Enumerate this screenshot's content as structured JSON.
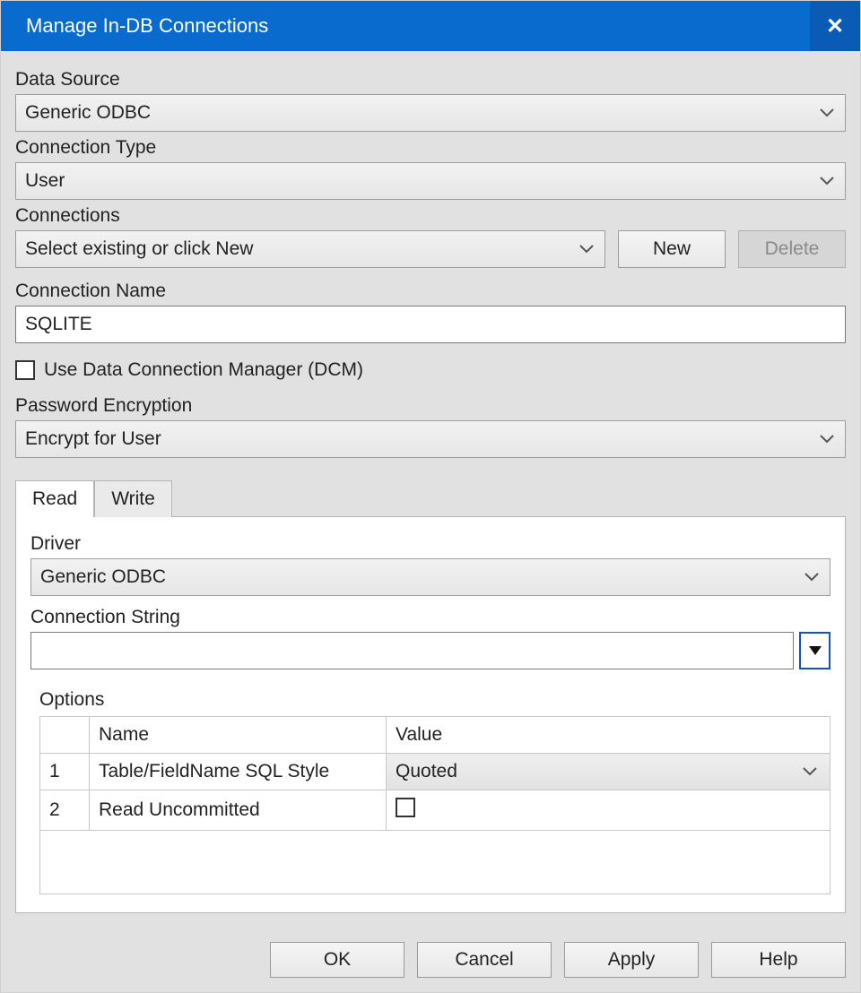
{
  "title": "Manage In-DB Connections",
  "close_glyph": "✕",
  "labels": {
    "data_source": "Data Source",
    "connection_type": "Connection Type",
    "connections": "Connections",
    "connection_name": "Connection Name",
    "use_dcm": "Use Data Connection Manager (DCM)",
    "password_encryption": "Password Encryption",
    "driver": "Driver",
    "connection_string": "Connection String",
    "options": "Options"
  },
  "values": {
    "data_source": "Generic ODBC",
    "connection_type": "User",
    "connections": "Select existing or click New",
    "connection_name": "SQLITE",
    "use_dcm_checked": false,
    "password_encryption": "Encrypt for User",
    "driver": "Generic ODBC",
    "connection_string": ""
  },
  "buttons": {
    "new": "New",
    "delete": "Delete",
    "ok": "OK",
    "cancel": "Cancel",
    "apply": "Apply",
    "help": "Help"
  },
  "tabs": {
    "read": "Read",
    "write": "Write"
  },
  "options_table": {
    "headers": {
      "idx": "",
      "name": "Name",
      "value": "Value"
    },
    "rows": [
      {
        "idx": "1",
        "name": "Table/FieldName SQL Style",
        "value": "Quoted",
        "type": "dropdown"
      },
      {
        "idx": "2",
        "name": "Read Uncommitted",
        "value": false,
        "type": "checkbox"
      }
    ]
  }
}
